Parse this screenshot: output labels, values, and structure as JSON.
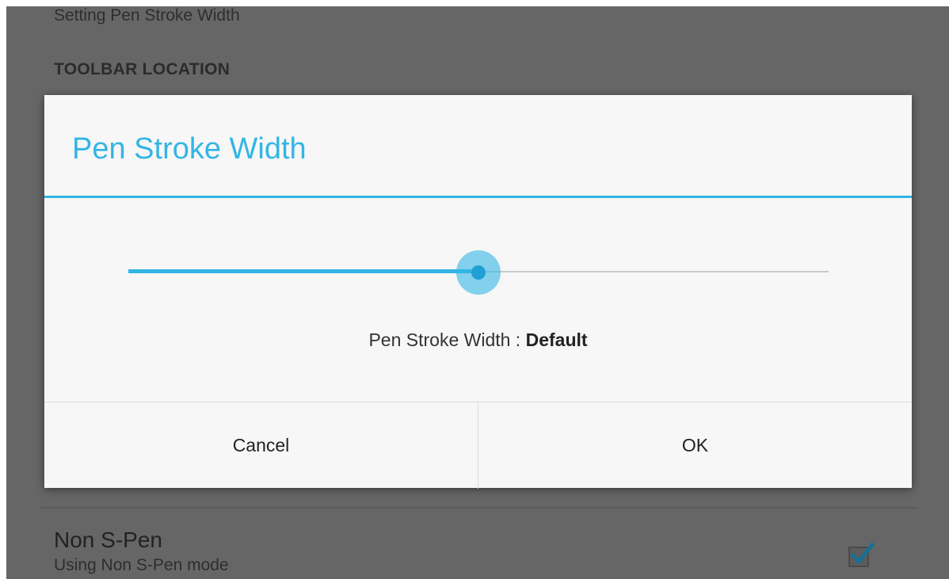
{
  "background": {
    "subtitle": "Setting Pen Stroke Width",
    "section_header": "TOOLBAR LOCATION",
    "non_spen": {
      "title": "Non S-Pen",
      "summary": "Using Non S-Pen mode",
      "checked": true
    }
  },
  "dialog": {
    "title": "Pen Stroke Width",
    "slider": {
      "value_fraction": 0.5
    },
    "value_label": "Pen Stroke Width : ",
    "value_text": "Default",
    "buttons": {
      "cancel": "Cancel",
      "ok": "OK"
    }
  },
  "colors": {
    "accent": "#33b5e5",
    "scrim": "#666666",
    "dialog_bg": "#f7f7f7"
  }
}
